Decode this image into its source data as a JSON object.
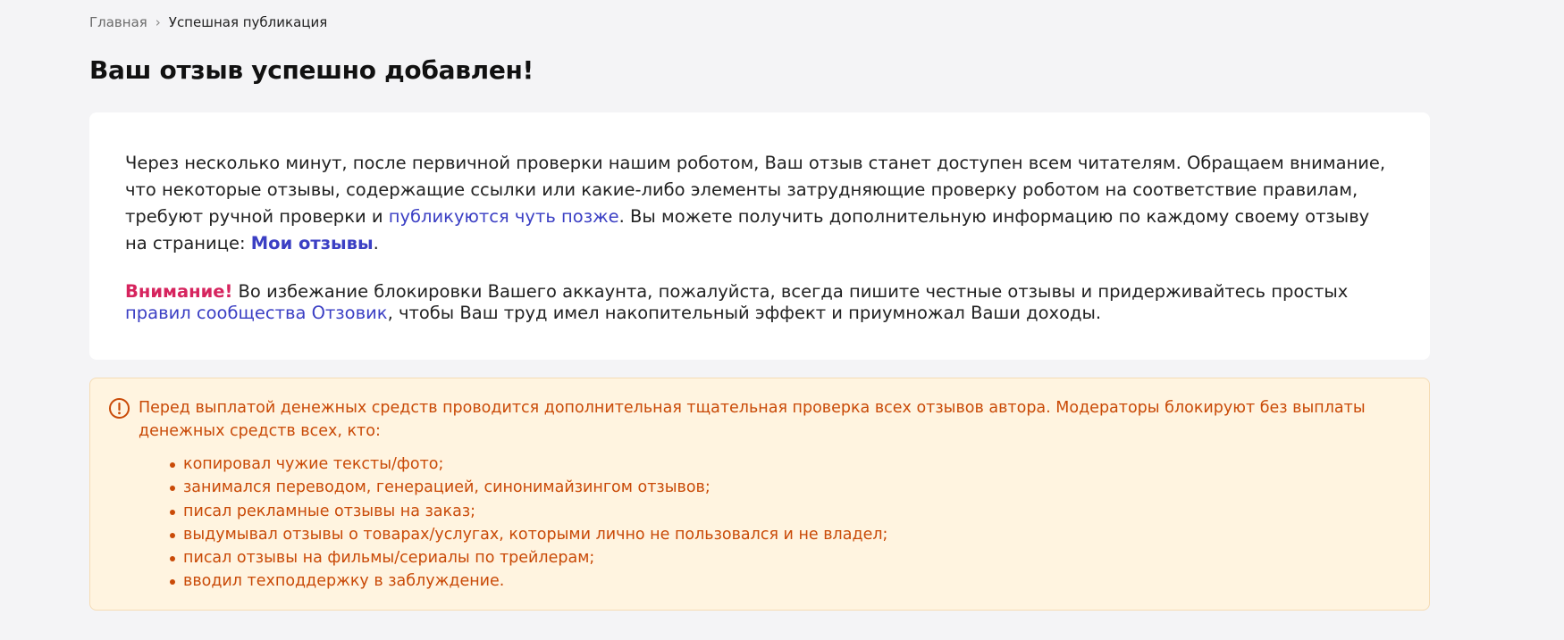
{
  "breadcrumb": {
    "home": "Главная",
    "separator": "›",
    "current": "Успешная публикация"
  },
  "title": "Ваш отзыв успешно добавлен!",
  "info": {
    "text_1": "Через несколько минут, после первичной проверки нашим роботом, Ваш отзыв станет доступен всем читателям. Обращаем внимание, что некоторые отзывы, содержащие ссылки или какие-либо элементы затрудняющие проверку роботом на соответствие правилам, требуют ручной проверки и ",
    "link_later": "публикуются чуть позже",
    "text_2": ". Вы можете получить дополнительную информацию по каждому своему отзыву на странице: ",
    "link_my_reviews": "Мои отзывы",
    "text_3": "."
  },
  "warning": {
    "label": "Внимание!",
    "text_1": " Во избежание блокировки Вашего аккаунта, пожалуйста, всегда пишите честные отзывы и придерживайтесь простых ",
    "link_rules": "правил сообщества Отзовик",
    "text_2": ", чтобы Ваш труд имел накопительный эффект и приумножал Ваши доходы."
  },
  "notice": {
    "icon": "alert-circle-icon",
    "text": "Перед выплатой денежных средств проводится дополнительная тщательная проверка всех отзывов автора. Модераторы блокируют без выплаты денежных средств всех, кто:",
    "items": [
      "копировал чужие тексты/фото;",
      "занимался переводом, генерацией, синонимайзингом отзывов;",
      "писал рекламные отзывы на заказ;",
      "выдумывал отзывы о товарах/услугах, которыми лично не пользовался и не владел;",
      "писал отзывы на фильмы/сериалы по трейлерам;",
      "вводил техподдержку в заблуждение."
    ]
  },
  "colors": {
    "background": "#f4f4f6",
    "link": "#3b3fc4",
    "attention": "#d6245e",
    "notice_background": "#fff4e0",
    "notice_text": "#c94a07"
  }
}
